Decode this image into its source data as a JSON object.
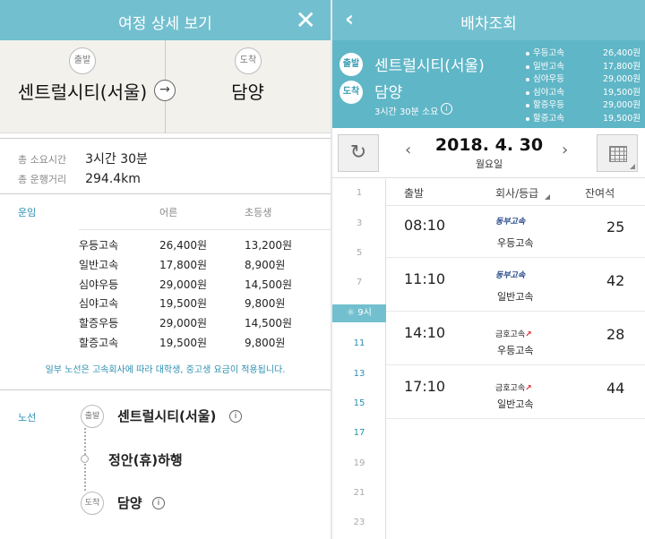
{
  "left": {
    "header": {
      "title": "여정 상세 보기",
      "close_icon": "close-icon"
    },
    "route": {
      "dep_label": "출발",
      "dep_name": "센트럴시티(서울)",
      "arr_label": "도착",
      "arr_name": "담양",
      "arrow_icon": "arrow-right-icon"
    },
    "info": {
      "time_label": "총 소요시간",
      "time_value": "3시간 30분",
      "dist_label": "총 운행거리",
      "dist_value": "294.4km"
    },
    "fares": {
      "label": "운임",
      "adult_header": "어른",
      "child_header": "초등생",
      "rows": [
        {
          "grade": "우등고속",
          "adult": "26,400원",
          "child": "13,200원"
        },
        {
          "grade": "일반고속",
          "adult": "17,800원",
          "child": "8,900원"
        },
        {
          "grade": "심야우등",
          "adult": "29,000원",
          "child": "14,500원"
        },
        {
          "grade": "심야고속",
          "adult": "19,500원",
          "child": "9,800원"
        },
        {
          "grade": "할증우등",
          "adult": "29,000원",
          "child": "14,500원"
        },
        {
          "grade": "할증고속",
          "adult": "19,500원",
          "child": "9,800원"
        }
      ],
      "note": "일부 노선은 고속회사에 따라 대학생, 중고생 요금이 적용됩니다."
    },
    "stops": {
      "label": "노선",
      "dep_label": "출발",
      "arr_label": "도착",
      "items": [
        "센트럴시티(서울)",
        "정안(휴)하행",
        "담양"
      ],
      "info_icon": "info-icon"
    }
  },
  "right": {
    "header": {
      "title": "배차조회",
      "back_icon": "chevron-left-icon"
    },
    "summary": {
      "dep_label": "출발",
      "dep_name": "센트럴시티(서울)",
      "arr_label": "도착",
      "arr_name": "담양",
      "duration": "3시간 30분 소요",
      "grades": [
        {
          "name": "우등고속",
          "price": "26,400원"
        },
        {
          "name": "일반고속",
          "price": "17,800원"
        },
        {
          "name": "심야우등",
          "price": "29,000원"
        },
        {
          "name": "심야고속",
          "price": "19,500원"
        },
        {
          "name": "할증우등",
          "price": "29,000원"
        },
        {
          "name": "할증고속",
          "price": "19,500원"
        }
      ]
    },
    "date_bar": {
      "date": "2018. 4. 30",
      "weekday": "월요일",
      "refresh_icon": "refresh-icon",
      "calendar_icon": "calendar-icon"
    },
    "hours": [
      "1",
      "3",
      "5",
      "7",
      "9시",
      "11",
      "13",
      "15",
      "17",
      "19",
      "21",
      "23"
    ],
    "active_hour": "9시",
    "table": {
      "col_departure": "출발",
      "col_company": "회사/등급",
      "col_seats": "잔여석",
      "rows": [
        {
          "time": "08:10",
          "company": "동부고속",
          "grade": "우등고속",
          "seats": "25"
        },
        {
          "time": "11:10",
          "company": "동부고속",
          "grade": "일반고속",
          "seats": "42"
        },
        {
          "time": "14:10",
          "company": "금호고속",
          "grade": "우등고속",
          "seats": "28"
        },
        {
          "time": "17:10",
          "company": "금호고속",
          "grade": "일반고속",
          "seats": "44"
        }
      ]
    }
  }
}
